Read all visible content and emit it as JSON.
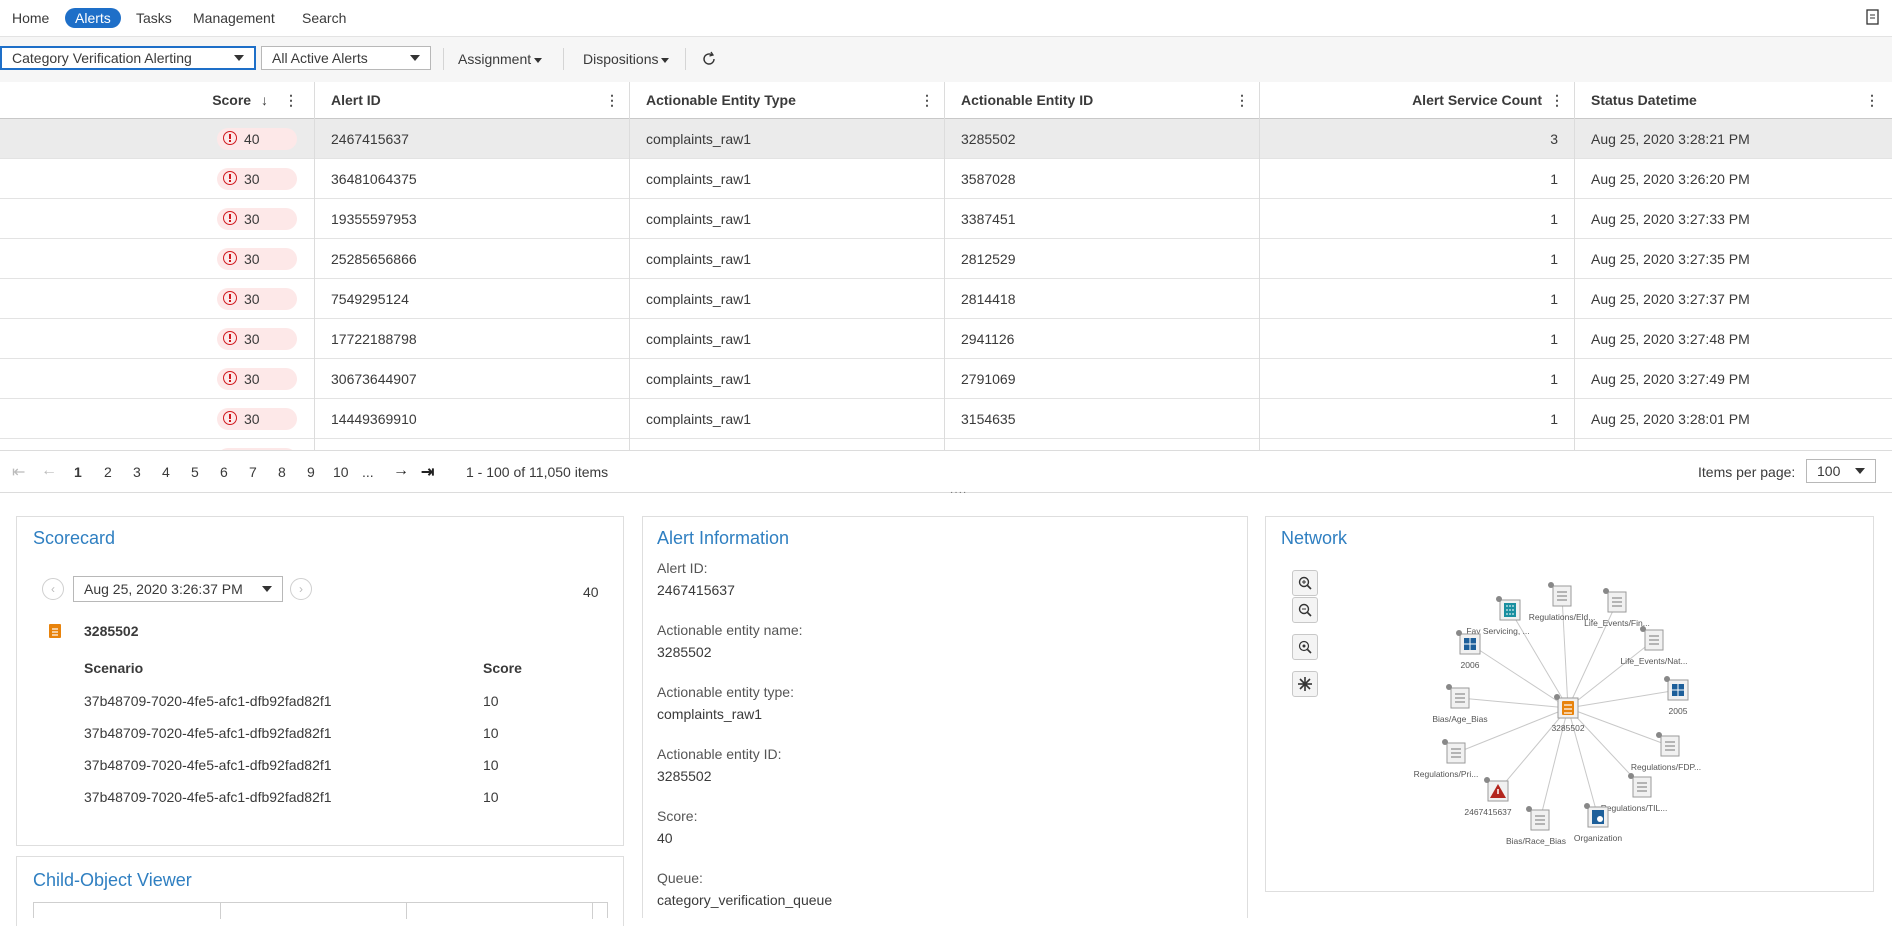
{
  "nav": {
    "items": [
      "Home",
      "Alerts",
      "Tasks",
      "Management",
      "Search"
    ],
    "active": "Alerts"
  },
  "toolbar": {
    "alert_type": "Category Verification Alerting",
    "alert_filter": "All Active Alerts",
    "assignment": "Assignment",
    "dispositions": "Dispositions"
  },
  "table": {
    "columns": [
      {
        "label": "Score",
        "sort_icon": "↓",
        "align": "right"
      },
      {
        "label": "Alert ID"
      },
      {
        "label": "Actionable Entity Type"
      },
      {
        "label": "Actionable Entity ID"
      },
      {
        "label": "Alert Service Count",
        "align": "right"
      },
      {
        "label": "Status Datetime"
      }
    ],
    "rows": [
      {
        "score": "40",
        "alert_id": "2467415637",
        "entity_type": "complaints_raw1",
        "entity_id": "3285502",
        "count": "3",
        "datetime": "Aug 25, 2020 3:28:21 PM"
      },
      {
        "score": "30",
        "alert_id": "36481064375",
        "entity_type": "complaints_raw1",
        "entity_id": "3587028",
        "count": "1",
        "datetime": "Aug 25, 2020 3:26:20 PM"
      },
      {
        "score": "30",
        "alert_id": "19355597953",
        "entity_type": "complaints_raw1",
        "entity_id": "3387451",
        "count": "1",
        "datetime": "Aug 25, 2020 3:27:33 PM"
      },
      {
        "score": "30",
        "alert_id": "25285656866",
        "entity_type": "complaints_raw1",
        "entity_id": "2812529",
        "count": "1",
        "datetime": "Aug 25, 2020 3:27:35 PM"
      },
      {
        "score": "30",
        "alert_id": "7549295124",
        "entity_type": "complaints_raw1",
        "entity_id": "2814418",
        "count": "1",
        "datetime": "Aug 25, 2020 3:27:37 PM"
      },
      {
        "score": "30",
        "alert_id": "17722188798",
        "entity_type": "complaints_raw1",
        "entity_id": "2941126",
        "count": "1",
        "datetime": "Aug 25, 2020 3:27:48 PM"
      },
      {
        "score": "30",
        "alert_id": "30673644907",
        "entity_type": "complaints_raw1",
        "entity_id": "2791069",
        "count": "1",
        "datetime": "Aug 25, 2020 3:27:49 PM"
      },
      {
        "score": "30",
        "alert_id": "14449369910",
        "entity_type": "complaints_raw1",
        "entity_id": "3154635",
        "count": "1",
        "datetime": "Aug 25, 2020 3:28:01 PM"
      }
    ]
  },
  "pager": {
    "pages": [
      "1",
      "2",
      "3",
      "4",
      "5",
      "6",
      "7",
      "8",
      "9",
      "10",
      "..."
    ],
    "current": "1",
    "range_text": "1 - 100 of 11,050 items",
    "items_per_page_label": "Items per page:",
    "items_per_page": "100"
  },
  "scorecard": {
    "title": "Scorecard",
    "datetime": "Aug 25, 2020 3:26:37 PM",
    "total_score": "40",
    "entity": "3285502",
    "col_scenario": "Scenario",
    "col_score": "Score",
    "rows": [
      {
        "scenario": "37b48709-7020-4fe5-afc1-dfb92fad82f1",
        "score": "10"
      },
      {
        "scenario": "37b48709-7020-4fe5-afc1-dfb92fad82f1",
        "score": "10"
      },
      {
        "scenario": "37b48709-7020-4fe5-afc1-dfb92fad82f1",
        "score": "10"
      },
      {
        "scenario": "37b48709-7020-4fe5-afc1-dfb92fad82f1",
        "score": "10"
      }
    ]
  },
  "child_viewer": {
    "title": "Child-Object Viewer"
  },
  "alert_info": {
    "title": "Alert Information",
    "fields": [
      {
        "label": "Alert ID:",
        "value": "2467415637"
      },
      {
        "label": "Actionable entity name:",
        "value": "3285502"
      },
      {
        "label": "Actionable entity type:",
        "value": "complaints_raw1"
      },
      {
        "label": "Actionable entity ID:",
        "value": "3285502"
      },
      {
        "label": "Score:",
        "value": "40"
      },
      {
        "label": "Queue:",
        "value": "category_verification_queue"
      }
    ]
  },
  "network": {
    "title": "Network",
    "center_label": "3285502",
    "nodes": [
      {
        "label": "Fay Servicing, ...",
        "icon": "building-icon"
      },
      {
        "label": "Regulations/Eld...",
        "icon": "document-icon"
      },
      {
        "label": "Life_Events/Fin...",
        "icon": "document-icon"
      },
      {
        "label": "Life_Events/Nat...",
        "icon": "document-icon"
      },
      {
        "label": "2005",
        "icon": "grid-icon"
      },
      {
        "label": "Regulations/FDP...",
        "icon": "document-icon"
      },
      {
        "label": "Regulations/TIL...",
        "icon": "document-icon"
      },
      {
        "label": "Organization",
        "icon": "organization-icon"
      },
      {
        "label": "Bias/Race_Bias",
        "icon": "document-icon"
      },
      {
        "label": "2467415637",
        "icon": "alert-triangle-icon"
      },
      {
        "label": "Regulations/Pri...",
        "icon": "document-icon"
      },
      {
        "label": "Bias/Age_Bias",
        "icon": "document-icon"
      },
      {
        "label": "2006",
        "icon": "grid-icon"
      }
    ]
  },
  "colors": {
    "accent": "#1e6fc8",
    "title_blue": "#2f7fc1",
    "alert_red": "#d0191e",
    "score_pill": "#fde8e8",
    "doc_orange": "#e8830c",
    "teal": "#1a8fa0"
  }
}
